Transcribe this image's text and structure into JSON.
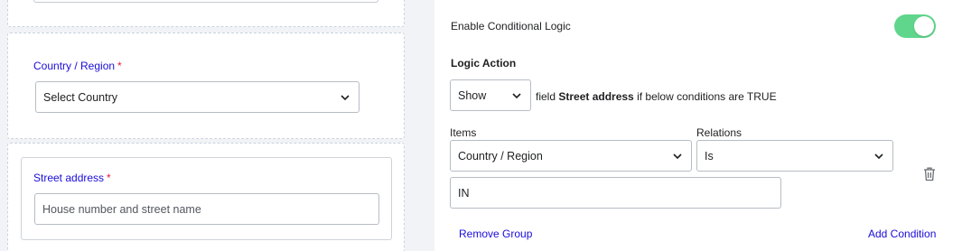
{
  "builder": {
    "country_field": {
      "label": "Country / Region",
      "required_mark": "*",
      "select_value": "Select Country"
    },
    "street_field": {
      "label": "Street address",
      "required_mark": "*",
      "placeholder": "House number and street name"
    }
  },
  "settings": {
    "enable_conditional_logic_label": "Enable Conditional Logic",
    "enable_conditional_logic_on": true,
    "logic_action_heading": "Logic Action",
    "action_select_value": "Show",
    "sentence_prefix": "field",
    "sentence_field_name": "Street address",
    "sentence_suffix": "if below conditions are TRUE",
    "condition": {
      "items_label": "Items",
      "items_value": "Country / Region",
      "relations_label": "Relations",
      "relations_value": "Is",
      "value_input": "IN"
    },
    "remove_group_label": "Remove Group",
    "add_condition_label": "Add Condition"
  },
  "icons": {
    "chevron": "chevron-down-icon",
    "delete": "trash-icon",
    "toggle": "toggle-switch"
  },
  "colors": {
    "accent_link": "#1a0dd9",
    "required": "#e5193a",
    "toggle_on": "#5fd68c"
  }
}
